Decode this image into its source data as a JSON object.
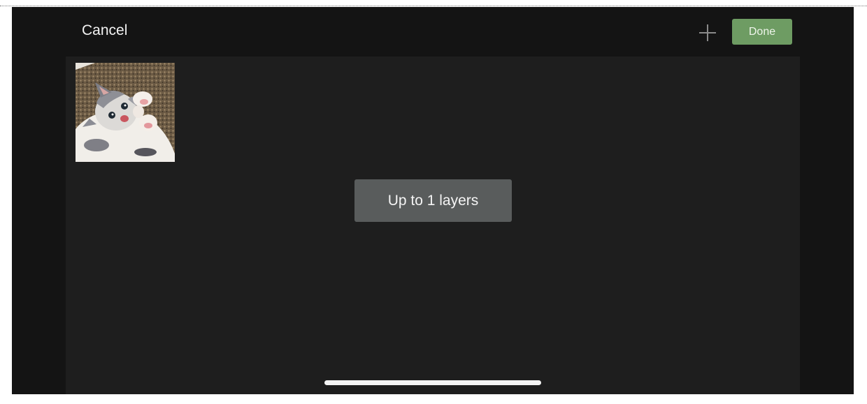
{
  "header": {
    "cancel_label": "Cancel",
    "add_icon": "plus-icon",
    "done_label": "Done"
  },
  "layers": [
    {
      "type": "image",
      "subject": "kitten photo"
    }
  ],
  "toast": {
    "message": "Up to 1 layers"
  },
  "colors": {
    "background": "#141414",
    "canvas": "#1e1e1e",
    "accent": "#6e9c63",
    "toast": "#595c5c"
  }
}
